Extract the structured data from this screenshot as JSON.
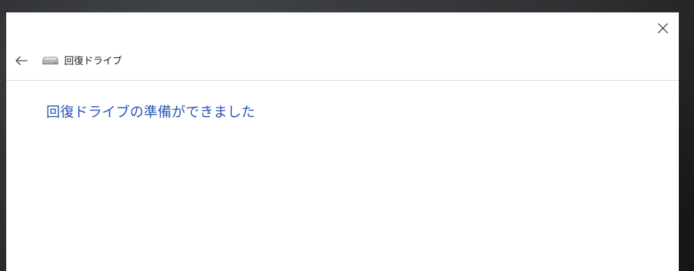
{
  "window": {
    "close_icon": "close-icon",
    "back_icon": "back-arrow-icon"
  },
  "breadcrumb": {
    "icon": "drive-icon",
    "label": "回復ドライブ"
  },
  "main": {
    "title": "回復ドライブの準備ができました"
  },
  "colors": {
    "title_accent": "#2b55b5",
    "dialog_bg": "#ffffff",
    "divider": "#d9d9d9"
  }
}
